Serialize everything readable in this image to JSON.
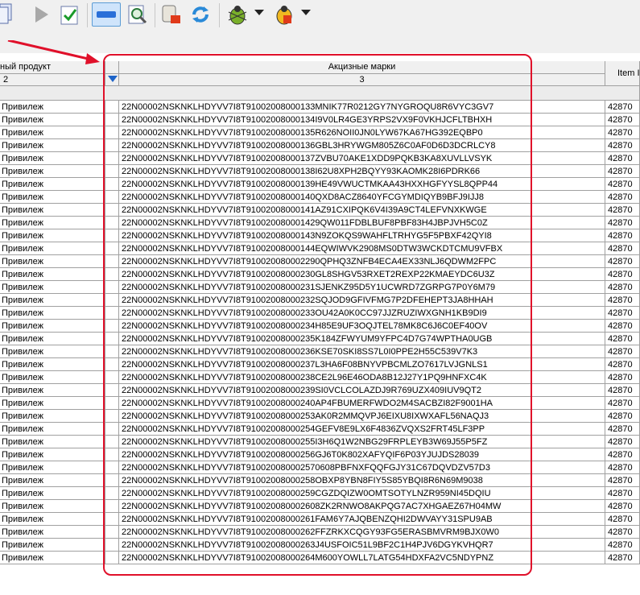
{
  "toolbar": {
    "buttons": [
      {
        "name": "document-icon",
        "selected": false
      },
      {
        "name": "play-icon",
        "selected": false
      },
      {
        "name": "check-icon",
        "selected": false
      },
      {
        "name": "minus-icon",
        "selected": true
      },
      {
        "name": "zoom-icon",
        "selected": false
      },
      {
        "name": "scroll-print-icon",
        "selected": false
      },
      {
        "name": "refresh-icon",
        "selected": false
      },
      {
        "name": "bug-green-icon",
        "selected": false
      },
      {
        "name": "bug-yellow-icon",
        "selected": false
      }
    ]
  },
  "grid": {
    "columns": [
      {
        "title": "ный продукт",
        "number": "2"
      },
      {
        "title": "",
        "number": ""
      },
      {
        "title": "Акцизные марки",
        "number": "3"
      },
      {
        "title": "Item II",
        "number": ""
      }
    ],
    "rows": [
      {
        "product": "Привилеж",
        "mark": "22N00002NSKNKLHDYVV7I8T91002008000133MNIK77R0212GY7NYGROQU8R6VYC3GV7",
        "item": "42870"
      },
      {
        "product": "Привилеж",
        "mark": "22N00002NSKNKLHDYVV7I8T91002008000134I9V0LR4GE3YRPS2VX9F0VKHJCFLTBHXH",
        "item": "42870"
      },
      {
        "product": "Привилеж",
        "mark": "22N00002NSKNKLHDYVV7I8T91002008000135R626NOII0JN0LYW67KA67HG392EQBP0",
        "item": "42870"
      },
      {
        "product": "Привилеж",
        "mark": "22N00002NSKNKLHDYVV7I8T91002008000136GBL3HRYWGM805Z6C0AF0D6D3DCRLCY8",
        "item": "42870"
      },
      {
        "product": "Привилеж",
        "mark": "22N00002NSKNKLHDYVV7I8T91002008000137ZVBU70AKE1XDD9PQKB3KA8XUVLLVSYK",
        "item": "42870"
      },
      {
        "product": "Привилеж",
        "mark": "22N00002NSKNKLHDYVV7I8T91002008000138I62U8XPH2BQYY93KAOMK28I6PDRK66",
        "item": "42870"
      },
      {
        "product": "Привилеж",
        "mark": "22N00002NSKNKLHDYVV7I8T91002008000139HE49VWUCTMKAA43HXXHGFYYSL8QPP44",
        "item": "42870"
      },
      {
        "product": "Привилеж",
        "mark": "22N00002NSKNKLHDYVV7I8T91002008000140QXD8ACZ8640YFCGYMDIQYB9BFJ9IJJ8",
        "item": "42870"
      },
      {
        "product": "Привилеж",
        "mark": "22N00002NSKNKLHDYVV7I8T91002008000141AZ91CXIPQK6V4I39A9CT4LEFVNXKWGE",
        "item": "42870"
      },
      {
        "product": "Привилеж",
        "mark": "22N00002NSKNKLHDYVV7I8T910020080001429QW011FDBLBUF8PBF83H4JBPJVH5C0Z",
        "item": "42870"
      },
      {
        "product": "Привилеж",
        "mark": "22N00002NSKNKLHDYVV7I8T91002008000143N9ZOKQS9WAHFLTRHYG5F5PBXF42QYI8",
        "item": "42870"
      },
      {
        "product": "Привилеж",
        "mark": "22N00002NSKNKLHDYVV7I8T91002008000144EQWIWVK2908MS0DTW3WCKDTCMU9VFBX",
        "item": "42870"
      },
      {
        "product": "Привилеж",
        "mark": "22N00002NSKNKLHDYVV7I8T910020080002290QPHQ3ZNFB4ECA4EX33NLJ6QDWM2FPC",
        "item": "42870"
      },
      {
        "product": "Привилеж",
        "mark": "22N00002NSKNKLHDYVV7I8T91002008000230GL8SHGV53RXET2REXP22KMAEYDC6U3Z",
        "item": "42870"
      },
      {
        "product": "Привилеж",
        "mark": "22N00002NSKNKLHDYVV7I8T91002008000231SJENKZ95D5Y1UCWRD7ZGRPG7P0Y6M79",
        "item": "42870"
      },
      {
        "product": "Привилеж",
        "mark": "22N00002NSKNKLHDYVV7I8T91002008000232SQJOD9GFIVFMG7P2DFEHEPT3JA8HHAH",
        "item": "42870"
      },
      {
        "product": "Привилеж",
        "mark": "22N00002NSKNKLHDYVV7I8T91002008000233OU42A0K0CC97JJZRUZIWXGNH1KB9DI9",
        "item": "42870"
      },
      {
        "product": "Привилеж",
        "mark": "22N00002NSKNKLHDYVV7I8T91002008000234H85E9UF3OQJTEL78MK8C6J6C0EF40OV",
        "item": "42870"
      },
      {
        "product": "Привилеж",
        "mark": "22N00002NSKNKLHDYVV7I8T91002008000235K184ZFWYUM9YFPC4D7G74WPTHA0UGB",
        "item": "42870"
      },
      {
        "product": "Привилеж",
        "mark": "22N00002NSKNKLHDYVV7I8T91002008000236KSE70SKI8SS7L0I0PPE2H55C539V7K3",
        "item": "42870"
      },
      {
        "product": "Привилеж",
        "mark": "22N00002NSKNKLHDYVV7I8T91002008000237L3HA6F08BNYVPBCMLZO7617LVJGNLS1",
        "item": "42870"
      },
      {
        "product": "Привилеж",
        "mark": "22N00002NSKNKLHDYVV7I8T91002008000238CE2L96E46ODA8B12J27Y1PQ9HNFXC4K",
        "item": "42870"
      },
      {
        "product": "Привилеж",
        "mark": "22N00002NSKNKLHDYVV7I8T91002008000239SI0VCLCOLAZDJ9R769UZX409IUV9QT2",
        "item": "42870"
      },
      {
        "product": "Привилеж",
        "mark": "22N00002NSKNKLHDYVV7I8T91002008000240AP4FBUMERFWDO2M4SACBZI82F9001HA",
        "item": "42870"
      },
      {
        "product": "Привилеж",
        "mark": "22N00002NSKNKLHDYVV7I8T91002008000253AK0R2MMQVPJ6EIXU8IXWXAFL56NAQJ3",
        "item": "42870"
      },
      {
        "product": "Привилеж",
        "mark": "22N00002NSKNKLHDYVV7I8T91002008000254GEFV8E9LX6F4836ZVQXS2FRT45LF3PP",
        "item": "42870"
      },
      {
        "product": "Привилеж",
        "mark": "22N00002NSKNKLHDYVV7I8T91002008000255I3H6Q1W2NBG29FRPLEYB3W69J55P5FZ",
        "item": "42870"
      },
      {
        "product": "Привилеж",
        "mark": "22N00002NSKNKLHDYVV7I8T91002008000256GJ6T0K802XAFYQIF6P03YJUJDS28039",
        "item": "42870"
      },
      {
        "product": "Привилеж",
        "mark": "22N00002NSKNKLHDYVV7I8T910020080002570608PBFNXFQQFGJY31C67DQVDZV57D3",
        "item": "42870"
      },
      {
        "product": "Привилеж",
        "mark": "22N00002NSKNKLHDYVV7I8T91002008000258OBXP8YBN8FIY5S85YBQI8R6N69M9038",
        "item": "42870"
      },
      {
        "product": "Привилеж",
        "mark": "22N00002NSKNKLHDYVV7I8T91002008000259CGZDQIZW0OMTSOTYLNZR959NI45DQIU",
        "item": "42870"
      },
      {
        "product": "Привилеж",
        "mark": "22N00002NSKNKLHDYVV7I8T910020080002608ZK2RNWO8AKPQG7AC7XHGAEZ67H04MW",
        "item": "42870"
      },
      {
        "product": "Привилеж",
        "mark": "22N00002NSKNKLHDYVV7I8T91002008000261FAM6Y7AJQBENZQHI2DWVAYY31SPU9AB",
        "item": "42870"
      },
      {
        "product": "Привилеж",
        "mark": "22N00002NSKNKLHDYVV7I8T91002008000262FFZRKXCQGY93FG5ERASBMVRM9BJX0W0",
        "item": "42870"
      },
      {
        "product": "Привилеж",
        "mark": "22N00002NSKNKLHDYVV7I8T91002008000263J4USFOIC51L9BF2C1H4PJV6DGYKVHQR7",
        "item": "42870"
      },
      {
        "product": "Привилеж",
        "mark": "22N00002NSKNKLHDYVV7I8T91002008000264M600YOWLL7LATG54HDXFA2VC5NDYPNZ",
        "item": "42870"
      }
    ]
  },
  "annotation": {
    "color": "#e0102a"
  }
}
